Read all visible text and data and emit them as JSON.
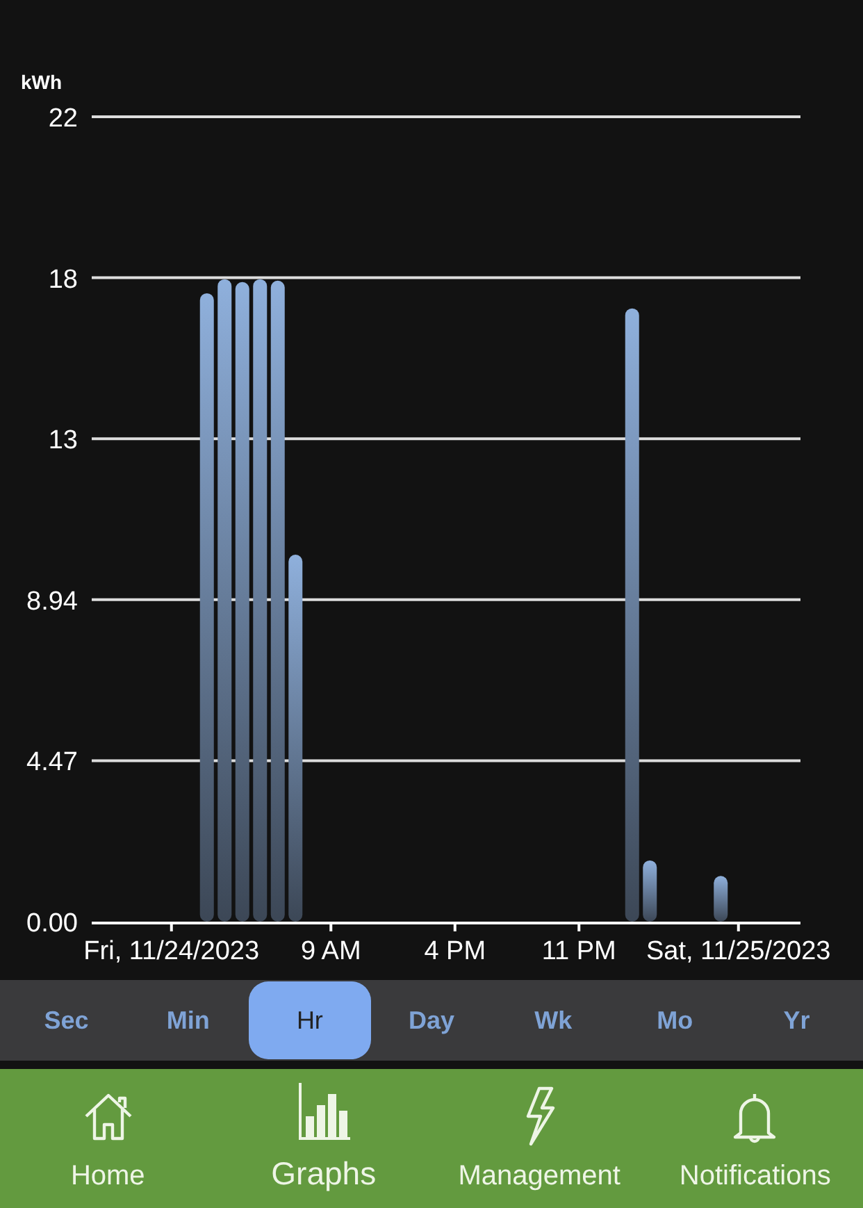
{
  "chart": {
    "chart_data": {
      "type": "bar",
      "ylabel": "kWh",
      "categories": [
        null,
        null,
        null,
        null,
        "Fri, 11/24/2023",
        null,
        null,
        null,
        null,
        null,
        null,
        null,
        null,
        "9 AM",
        null,
        null,
        null,
        null,
        null,
        null,
        "4 PM",
        null,
        null,
        null,
        null,
        null,
        null,
        "11 PM",
        null,
        null,
        null,
        null,
        null,
        null,
        null,
        null,
        "Sat, 11/25/2023",
        null,
        null,
        null
      ],
      "series": [
        {
          "color": "#8fb0dc",
          "values": [
            null,
            null,
            null,
            null,
            null,
            null,
            17.45,
            17.84,
            17.76,
            17.84,
            17.8,
            10.19,
            null,
            null,
            null,
            null,
            null,
            null,
            null,
            null,
            null,
            null,
            null,
            null,
            null,
            null,
            null,
            null,
            null,
            null,
            17.03,
            1.7,
            null,
            null,
            null,
            1.27,
            null,
            null,
            null,
            null
          ]
        }
      ],
      "ylim": [
        0,
        22.35
      ],
      "grid": true,
      "yticks": [
        {
          "value": 0,
          "label": "0.00"
        },
        {
          "value": 4.47,
          "label": "4.47"
        },
        {
          "value": 8.94,
          "label": "8.94"
        },
        {
          "value": 13.41,
          "label": "13"
        },
        {
          "value": 17.88,
          "label": "18"
        },
        {
          "value": 22.35,
          "label": "22"
        }
      ]
    }
  },
  "ranges": [
    {
      "label": "Sec",
      "selected": false
    },
    {
      "label": "Min",
      "selected": false
    },
    {
      "label": "Hr",
      "selected": true
    },
    {
      "label": "Day",
      "selected": false
    },
    {
      "label": "Wk",
      "selected": false
    },
    {
      "label": "Mo",
      "selected": false
    },
    {
      "label": "Yr",
      "selected": false
    }
  ],
  "nav": [
    {
      "kind": "home",
      "label": "Home",
      "selected": false
    },
    {
      "kind": "graphs",
      "label": "Graphs",
      "selected": true
    },
    {
      "kind": "management",
      "label": "Management",
      "selected": false
    },
    {
      "kind": "notifications",
      "label": "Notifications",
      "selected": false
    }
  ]
}
